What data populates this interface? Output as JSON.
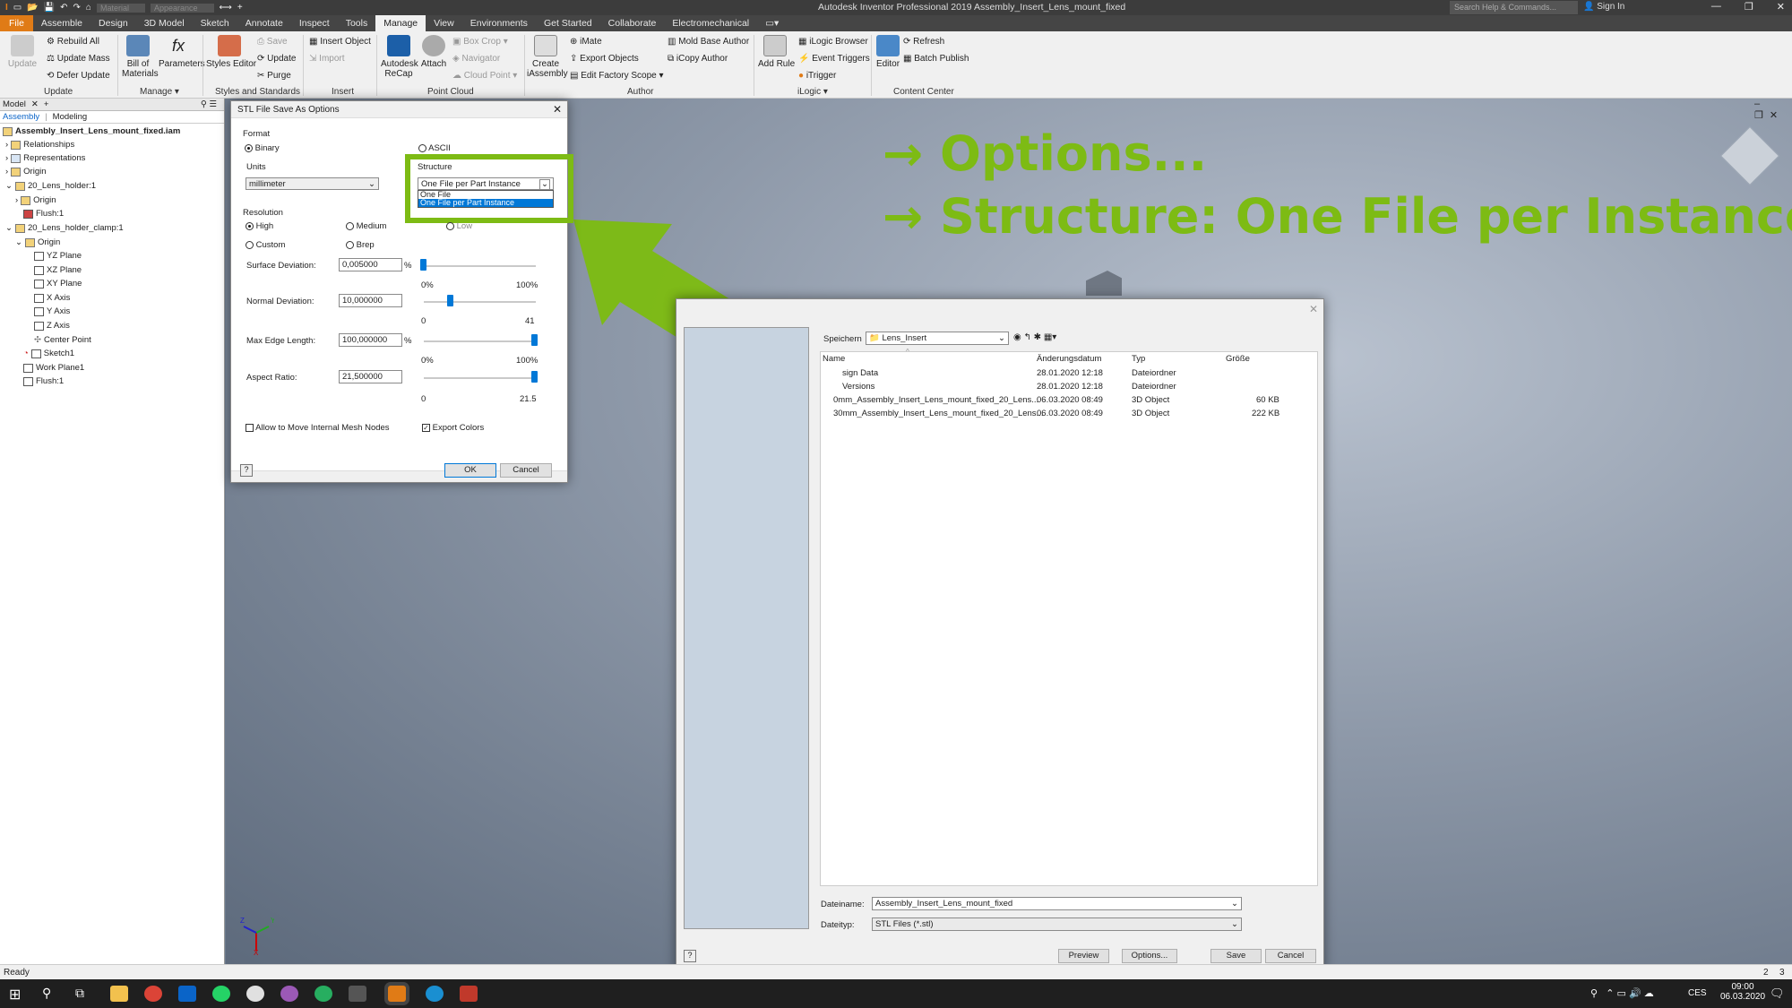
{
  "titlebar": {
    "title": "Autodesk Inventor Professional 2019   Assembly_Insert_Lens_mount_fixed",
    "combo1": "Material",
    "combo2": "Appearance",
    "search_placeholder": "Search Help & Commands...",
    "signin": "Sign In"
  },
  "menu": {
    "file": "File",
    "tabs": [
      "Assemble",
      "Design",
      "3D Model",
      "Sketch",
      "Annotate",
      "Inspect",
      "Tools",
      "Manage",
      "View",
      "Environments",
      "Get Started",
      "Collaborate",
      "Electromechanical"
    ],
    "active": "Manage"
  },
  "ribbon": {
    "update": {
      "update": "Update",
      "rebuild_all": "Rebuild All",
      "update_mass": "Update Mass",
      "defer_update": "Defer Update",
      "group": "Update"
    },
    "manage": {
      "bom_line1": "Bill of",
      "bom_line2": "Materials",
      "parameters": "Parameters",
      "group": "Manage"
    },
    "styles": {
      "editor": "Styles Editor",
      "save": "Save",
      "update": "Update",
      "purge": "Purge",
      "group": "Styles and Standards"
    },
    "insert": {
      "insert_object": "Insert Object",
      "import": "Import",
      "group": "Insert"
    },
    "pointcloud": {
      "recap_line1": "Autodesk",
      "recap_line2": "ReCap",
      "attach": "Attach",
      "box_crop": "Box Crop",
      "navigator": "Navigator",
      "cloud_point": "Cloud Point",
      "group": "Point Cloud"
    },
    "author": {
      "create_line1": "Create",
      "create_line2": "iAssembly",
      "imate": "iMate",
      "export_objects": "Export Objects",
      "edit_factory_scope": "Edit Factory Scope",
      "mold_base_author": "Mold Base Author",
      "icopy_author": "iCopy Author",
      "group": "Author"
    },
    "ilogic": {
      "add_rule": "Add Rule",
      "browser": "iLogic Browser",
      "event_triggers": "Event Triggers",
      "itrigger": "iTrigger",
      "group": "iLogic"
    },
    "content_center": {
      "editor": "Editor",
      "refresh": "Refresh",
      "batch_publish": "Batch Publish",
      "group": "Content Center"
    }
  },
  "browser": {
    "tab_model": "Model",
    "sub_assembly": "Assembly",
    "sub_modeling": "Modeling",
    "nodes": [
      "Assembly_Insert_Lens_mount_fixed.iam",
      "Relationships",
      "Representations",
      "Origin",
      "20_Lens_holder:1",
      "Origin",
      "Flush:1",
      "20_Lens_holder_clamp:1",
      "Origin",
      "YZ Plane",
      "XZ Plane",
      "XY Plane",
      "X Axis",
      "Y Axis",
      "Z Axis",
      "Center Point",
      "Sketch1",
      "Work Plane1",
      "Flush:1"
    ]
  },
  "stl_dialog": {
    "title": "STL File Save As Options",
    "format_label": "Format",
    "binary": "Binary",
    "ascii": "ASCII",
    "units_label": "Units",
    "units_value": "millimeter",
    "structure_label": "Structure",
    "structure_value": "One File per Part Instance",
    "structure_options": [
      "One File",
      "One File per Part Instance"
    ],
    "resolution_label": "Resolution",
    "res_high": "High",
    "res_medium": "Medium",
    "res_low": "Low",
    "res_custom": "Custom",
    "res_brep": "Brep",
    "surface_dev_label": "Surface Deviation:",
    "surface_dev_value": "0,005000",
    "surface_dev_unit": "%",
    "surface_dev_min": "0%",
    "surface_dev_max": "100%",
    "surface_dev_level": 0.0,
    "normal_dev_label": "Normal Deviation:",
    "normal_dev_value": "10,000000",
    "normal_dev_min": "0",
    "normal_dev_max": "41",
    "normal_dev_level": 0.24,
    "max_edge_label": "Max Edge Length:",
    "max_edge_value": "100,000000",
    "max_edge_unit": "%",
    "max_edge_min": "0%",
    "max_edge_max": "100%",
    "max_edge_level": 1.0,
    "aspect_label": "Aspect Ratio:",
    "aspect_value": "21,500000",
    "aspect_min": "0",
    "aspect_max": "21.5",
    "aspect_level": 1.0,
    "allow_move": "Allow to Move Internal Mesh Nodes",
    "export_colors": "Export Colors",
    "ok": "OK",
    "cancel": "Cancel"
  },
  "save_dialog": {
    "location_label": "Speichern",
    "location_value": "Lens_Insert",
    "columns": [
      "Name",
      "Änderungsdatum",
      "Typ",
      "Größe"
    ],
    "rows": [
      {
        "name": "sign Data",
        "date": "28.01.2020 12:18",
        "type": "Dateiordner",
        "size": ""
      },
      {
        "name": "Versions",
        "date": "28.01.2020 12:18",
        "type": "Dateiordner",
        "size": ""
      },
      {
        "name": "0mm_Assembly_Insert_Lens_mount_fixed_20_Lens...",
        "date": "06.03.2020 08:49",
        "type": "3D Object",
        "size": "60 KB"
      },
      {
        "name": "30mm_Assembly_Insert_Lens_mount_fixed_20_Lens...",
        "date": "06.03.2020 08:49",
        "type": "3D Object",
        "size": "222 KB"
      }
    ],
    "filename_label": "Dateiname:",
    "filename_value": "Assembly_Insert_Lens_mount_fixed",
    "filetype_label": "Dateityp:",
    "filetype_value": "STL Files (*.stl)",
    "preview": "Preview",
    "options": "Options...",
    "save": "Save",
    "cancel": "Cancel"
  },
  "annotation": {
    "line1": "→ Options...",
    "line2": "→ Structure: One File per Instance",
    "color": "#7dbb14"
  },
  "status": {
    "ready": "Ready",
    "count1": "2",
    "count2": "3"
  },
  "taskbar": {
    "lang": "CES",
    "time": "09:00",
    "date": "06.03.2020"
  }
}
